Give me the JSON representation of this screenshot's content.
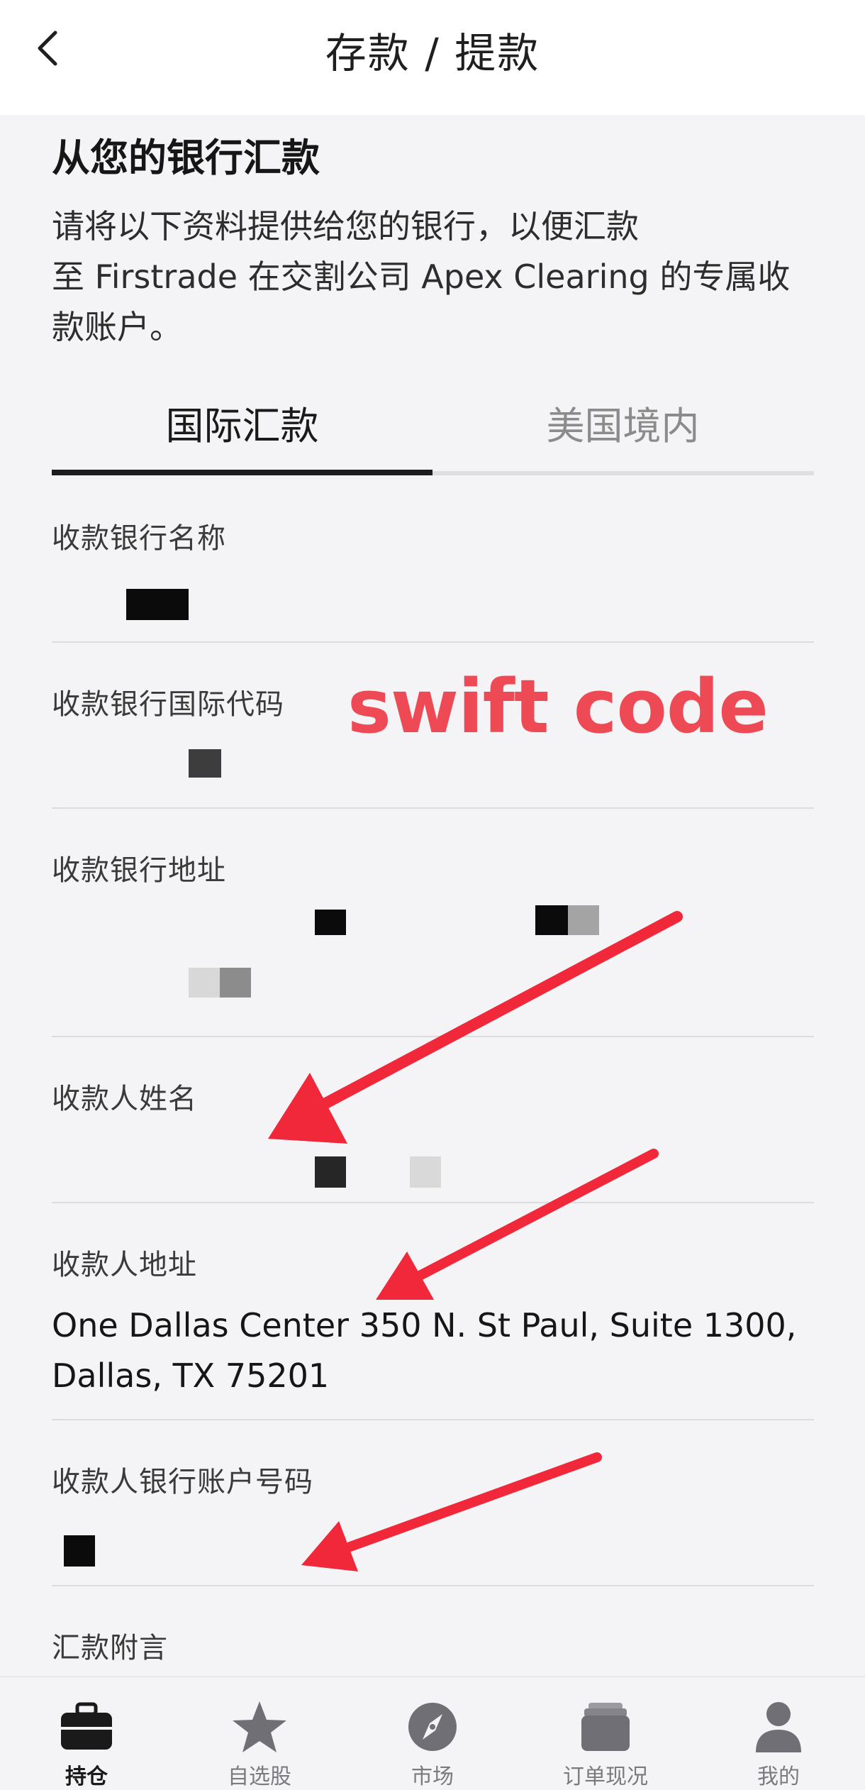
{
  "header": {
    "title": "存款 / 提款",
    "back_icon": "chevron-left-icon"
  },
  "intro": {
    "headline": "从您的银行汇款",
    "lines": [
      "请将以下资料提供给您的银行，以便汇款",
      "至 Firstrade 在交割公司 Apex Clearing 的专属收",
      "款账户。"
    ]
  },
  "tabs": [
    {
      "label": "国际汇款",
      "active": true
    },
    {
      "label": "美国境内",
      "active": false
    }
  ],
  "fields": {
    "bank_name": {
      "label": "收款银行名称"
    },
    "swift": {
      "label": "收款银行国际代码"
    },
    "bank_address": {
      "label": "收款银行地址"
    },
    "beneficiary_name": {
      "label": "收款人姓名"
    },
    "beneficiary_address": {
      "label": "收款人地址",
      "lines": [
        "One Dallas Center 350 N. St Paul, Suite 1300,",
        "Dallas, TX 75201"
      ]
    },
    "account_number": {
      "label": "收款人银行账户号码"
    },
    "memo": {
      "label": "汇款附言"
    }
  },
  "annotation": {
    "text": "swift code",
    "color": "#ee4a55"
  },
  "tabbar": [
    {
      "label": "持仓",
      "icon": "briefcase-icon",
      "active": true
    },
    {
      "label": "自选股",
      "icon": "star-icon",
      "active": false
    },
    {
      "label": "市场",
      "icon": "compass-icon",
      "active": false
    },
    {
      "label": "订单现况",
      "icon": "orders-stack-icon",
      "active": false
    },
    {
      "label": "我的",
      "icon": "user-icon",
      "active": false
    }
  ]
}
